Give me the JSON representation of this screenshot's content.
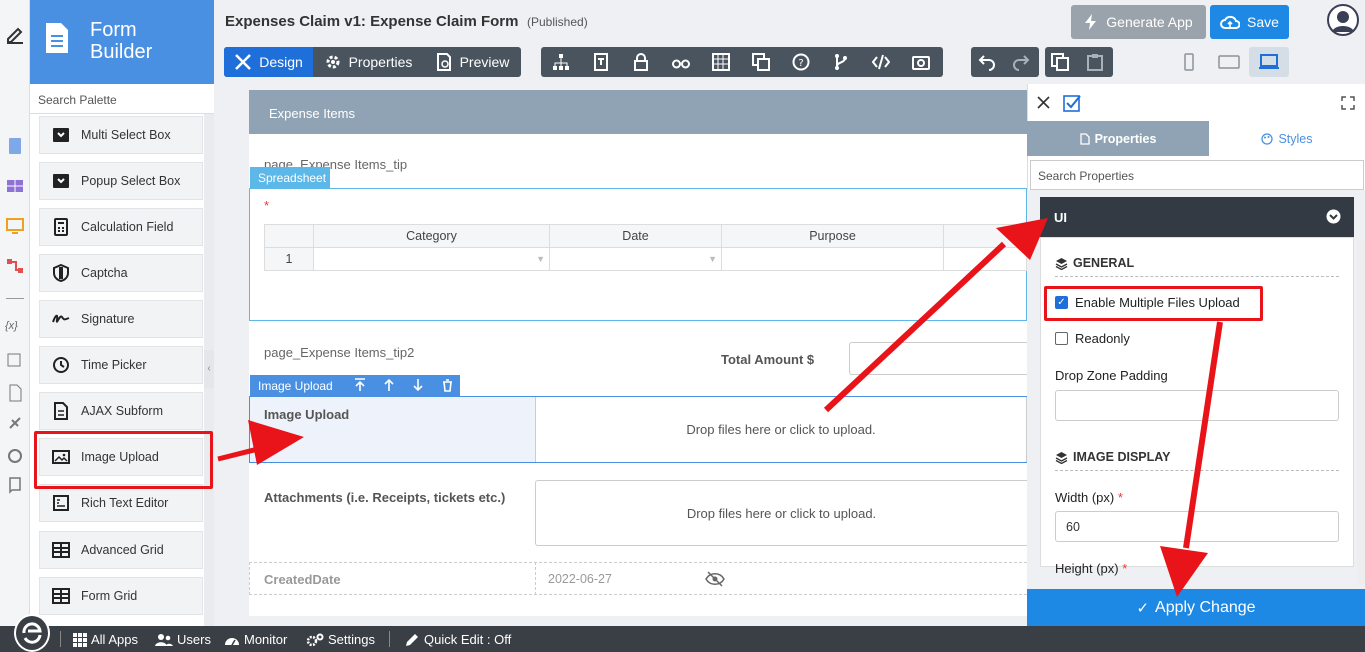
{
  "brand": {
    "line1": "Form",
    "line2": "Builder"
  },
  "palette": {
    "search_placeholder": "Search Palette",
    "items": [
      {
        "label": "Multi Select Box",
        "icon": "dropdown-icon"
      },
      {
        "label": "Popup Select Box",
        "icon": "dropdown-icon"
      },
      {
        "label": "Calculation Field",
        "icon": "calculator-icon"
      },
      {
        "label": "Captcha",
        "icon": "shield-icon"
      },
      {
        "label": "Signature",
        "icon": "signature-icon"
      },
      {
        "label": "Time Picker",
        "icon": "clock-icon"
      },
      {
        "label": "AJAX Subform",
        "icon": "subform-icon"
      },
      {
        "label": "Image Upload",
        "icon": "image-icon"
      },
      {
        "label": "Rich Text Editor",
        "icon": "rich-text-icon"
      },
      {
        "label": "Advanced Grid",
        "icon": "grid-icon"
      },
      {
        "label": "Form Grid",
        "icon": "grid-icon"
      }
    ]
  },
  "header": {
    "title": "Expenses Claim v1: Expense Claim Form",
    "status": "(Published)",
    "generate_label": "Generate App",
    "save_label": "Save",
    "tabs": [
      "Design",
      "Properties",
      "Preview"
    ]
  },
  "form": {
    "section_title": "Expense Items",
    "tip1": "page_Expense Items_tip",
    "spreadsheet_tag": "Spreadsheet",
    "required_mark": "*",
    "columns": [
      "Category",
      "Date",
      "Purpose"
    ],
    "row_number": "1",
    "tip2": "page_Expense Items_tip2",
    "total_label": "Total Amount $",
    "image_tag": "Image Upload",
    "image_label": "Image Upload",
    "drop_text": "Drop files here or click to upload.",
    "attachments_label": "Attachments (i.e. Receipts, tickets etc.)",
    "created_label": "CreatedDate",
    "created_value": "2022-06-27"
  },
  "properties": {
    "tab_properties": "Properties",
    "tab_styles": "Styles",
    "search_placeholder": "Search Properties",
    "group": "UI",
    "general_title": "GENERAL",
    "multiple_label": "Enable Multiple Files Upload",
    "multiple_checked": true,
    "readonly_label": "Readonly",
    "readonly_checked": false,
    "padding_label": "Drop Zone Padding",
    "padding_value": "",
    "image_display_title": "IMAGE DISPLAY",
    "width_label": "Width (px)",
    "width_value": "60",
    "height_label": "Height (px)",
    "required_mark": "*",
    "apply_label": "Apply Change"
  },
  "bottom": {
    "all_apps": "All Apps",
    "users": "Users",
    "monitor": "Monitor",
    "settings": "Settings",
    "quick_edit": "Quick Edit : Off"
  },
  "colors": {
    "accent": "#1e88e5",
    "brand": "#4a90e2",
    "annotation": "#e8141a"
  }
}
